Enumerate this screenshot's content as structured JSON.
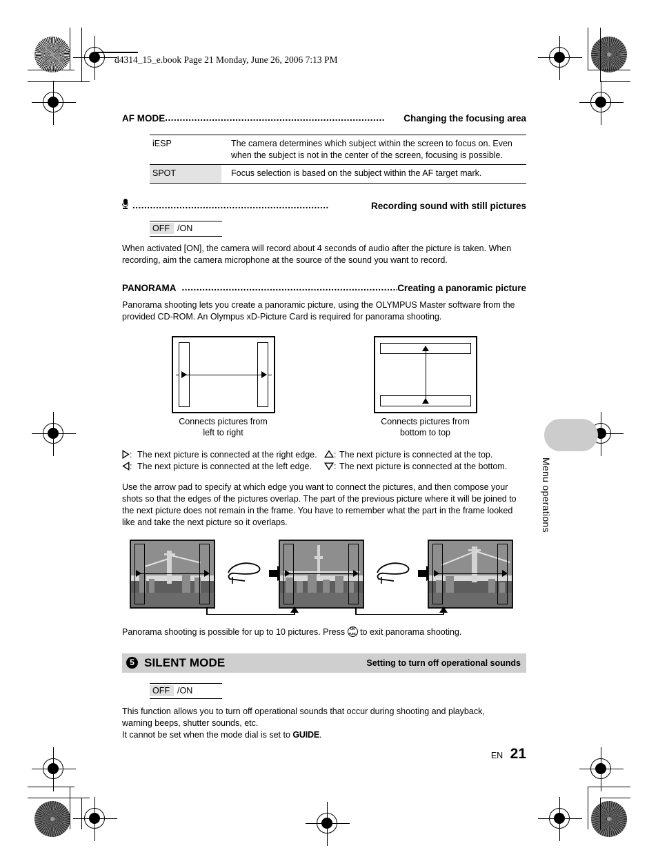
{
  "header": {
    "book_info": "d4314_15_e.book  Page 21  Monday, June 26, 2006  7:13 PM"
  },
  "sections": {
    "af_mode": {
      "name": "AF MODE",
      "leader": "...........................................................................",
      "desc": "Changing the focusing area",
      "table": {
        "rows": [
          {
            "key": "iESP",
            "value": "The camera determines which subject within the screen to focus on. Even when the subject is not in the center of the screen, focusing is possible.",
            "shaded": false
          },
          {
            "key": "SPOT",
            "value": "Focus selection is based on the subject within the AF target mark.",
            "shaded": true
          }
        ]
      }
    },
    "sound_rec": {
      "icon": "microphone-icon",
      "leader": "...................................................................",
      "desc": "Recording sound with still pictures",
      "chip": {
        "off": "OFF",
        "on": "/ON"
      },
      "body": "When activated [ON], the camera will record about 4 seconds of audio after the picture is taken. When recording, aim the camera microphone at the source of the sound you want to record."
    },
    "panorama": {
      "name": "PANORAMA",
      "leader": "................................................................................",
      "desc": "Creating a panoramic picture",
      "body": "Panorama shooting lets you create a panoramic picture, using the OLYMPUS Master software from the provided CD-ROM. An Olympus xD-Picture Card is required for panorama shooting.",
      "diagrams": [
        {
          "id": "left-to-right",
          "caption_line1": "Connects pictures from",
          "caption_line2": "left to right"
        },
        {
          "id": "bottom-to-top",
          "caption_line1": "Connects pictures from",
          "caption_line2": "bottom to top"
        }
      ],
      "legend": {
        "left": [
          {
            "glyph": "triangle-right-icon",
            "text": "The next picture is connected at the right edge."
          },
          {
            "glyph": "triangle-left-icon",
            "text": "The next picture is connected at the left edge."
          }
        ],
        "right": [
          {
            "glyph": "triangle-up-icon",
            "text": "The next picture is connected at the top."
          },
          {
            "glyph": "triangle-down-icon",
            "text": "The next picture is connected at the bottom."
          }
        ]
      },
      "instructions": "Use the arrow pad to specify at which edge you want to connect the pictures, and then compose your shots so that the edges of the pictures overlap. The part of the previous picture where it will be joined to the next picture does not remain in the frame. You have to remember what the part in the frame looked like and take the next picture so it overlaps.",
      "exit_note_before": "Panorama shooting is possible for up to 10 pictures. Press",
      "exit_note_after": "to exit panorama shooting.",
      "ok_button": {
        "top": "OK",
        "bottom": "FUNC"
      }
    },
    "silent_mode": {
      "number": "5",
      "title": "SILENT MODE",
      "desc": "Setting to turn off operational sounds",
      "chip": {
        "off": "OFF",
        "on": "/ON"
      },
      "body_line1": "This function allows you to turn off  operational sounds that occur during shooting and playback,",
      "body_line2": "warning beeps, shutter sounds, etc.",
      "body_line3_before": "It cannot be set when the mode dial is set to",
      "body_line3_mark": "GUIDE",
      "body_line3_after": "."
    }
  },
  "side_tab": {
    "label": "Menu operations"
  },
  "footer": {
    "lang": "EN",
    "page_number": "21"
  },
  "colors": {
    "shade": "#e3e3e3",
    "banner": "#cfcfcf",
    "tab": "#cccccc"
  }
}
